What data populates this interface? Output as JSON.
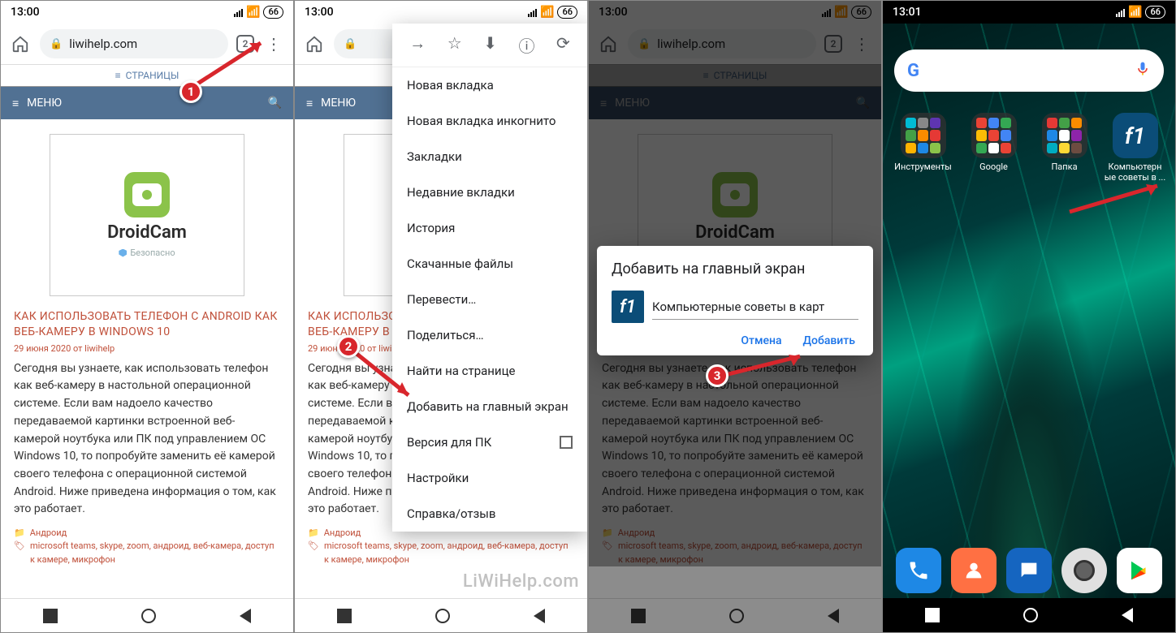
{
  "status": {
    "time": "13:00",
    "time4": "13:01",
    "battery": "66"
  },
  "browser": {
    "url": "liwihelp.com",
    "tabs": "2"
  },
  "site": {
    "pages": "СТРАНИЦЫ",
    "menu": "МЕНЮ"
  },
  "article": {
    "logo_text": "DroidCam",
    "safe": "Безопасно",
    "title": "КАК ИСПОЛЬЗОВАТЬ ТЕЛЕФОН С ANDROID КАК ВЕБ-КАМЕРУ В WINDOWS 10",
    "title2": "КАК ИСПОЛЬЗОВАТЬ\nВЕБ-КАМЕРУ В",
    "meta": "29 июня 2020 от liwihelp",
    "body": "Сегодня вы узнаете, как использовать телефон как веб-камеру в настольной операционной системе. Если вам надоело качество передаваемой картинки встроенной веб-камерой ноутбука или ПК под управлением ОС Windows 10, то попробуйте заменить её камерой своего телефона с операционной системой Android. Ниже приведена информация о том, как это работает.",
    "cat": "Андроид",
    "tags": "microsoft teams, skype, zoom, андроид, веб-камера, доступ к камере, микрофон"
  },
  "menu": {
    "new_tab": "Новая вкладка",
    "incognito": "Новая вкладка инкогнито",
    "bookmarks": "Закладки",
    "recent": "Недавние вкладки",
    "history": "История",
    "downloads": "Скачанные файлы",
    "translate": "Перевести…",
    "share": "Поделиться…",
    "find": "Найти на странице",
    "add_home": "Добавить на главный экран",
    "desktop": "Версия для ПК",
    "settings": "Настройки",
    "help": "Справка/отзыв"
  },
  "dialog": {
    "title": "Добавить на главный экран",
    "input": "Компьютерные советы в карт",
    "cancel": "Отмена",
    "add": "Добавить"
  },
  "home": {
    "folders": [
      "Инструменты",
      "Google",
      "Папка"
    ],
    "shortcut": "Компьютерн\nые советы в ..."
  },
  "watermark": "LiWiHelp.com",
  "callouts": {
    "c1": "1",
    "c2": "2",
    "c3": "3"
  }
}
